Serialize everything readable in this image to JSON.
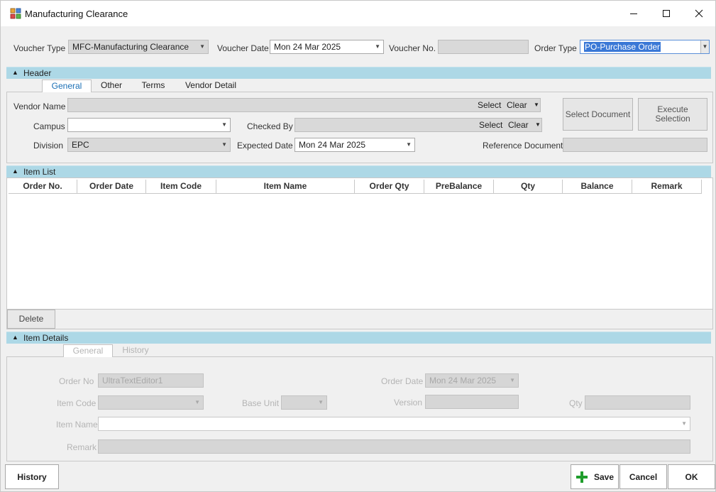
{
  "window": {
    "title": "Manufacturing Clearance"
  },
  "top": {
    "voucher_type_label": "Voucher Type",
    "voucher_type_value": "MFC-Manufacturing Clearance",
    "voucher_date_label": "Voucher Date",
    "voucher_date_value": "Mon 24 Mar 2025",
    "voucher_no_label": "Voucher No.",
    "voucher_no_value": "",
    "order_type_label": "Order Type",
    "order_type_value": "PO-Purchase Order"
  },
  "header": {
    "title": "Header",
    "tabs": [
      "General",
      "Other",
      "Terms",
      "Vendor Detail"
    ],
    "vendor_name_label": "Vendor Name",
    "vendor_name_value": "",
    "select_label": "Select",
    "clear_label": "Clear",
    "campus_label": "Campus",
    "campus_value": "",
    "checked_by_label": "Checked By",
    "checked_by_value": "",
    "division_label": "Division",
    "division_value": "EPC",
    "expected_date_label": "Expected Date",
    "expected_date_value": "Mon 24 Mar 2025",
    "reference_document_label": "Reference Document",
    "reference_document_value": "",
    "select_document_label": "Select Document",
    "execute_selection_line1": "Execute",
    "execute_selection_line2": "Selection"
  },
  "item_list": {
    "title": "Item List",
    "columns": [
      "Order No.",
      "Order Date",
      "Item Code",
      "Item Name",
      "Order Qty",
      "PreBalance",
      "Qty",
      "Balance",
      "Remark"
    ],
    "rows": [],
    "delete_label": "Delete"
  },
  "item_details": {
    "title": "Item Details",
    "tabs": [
      "General",
      "History"
    ],
    "order_no_label": "Order No",
    "order_no_value": "UltraTextEditor1",
    "order_date_label": "Order Date",
    "order_date_value": "Mon 24 Mar 2025",
    "item_code_label": "Item Code",
    "item_code_value": "",
    "base_unit_label": "Base Unit",
    "base_unit_value": "",
    "version_label": "Version",
    "version_value": "",
    "qty_label": "Qty",
    "qty_value": "",
    "item_name_label": "Item Name",
    "item_name_value": "",
    "remark_label": "Remark",
    "remark_value": ""
  },
  "footer": {
    "history_label": "History",
    "save_label": "Save",
    "cancel_label": "Cancel",
    "ok_label": "OK"
  },
  "colors": {
    "section_header": "#add8e6",
    "active_tab_text": "#1a6fb5",
    "selection_highlight": "#3a78d6",
    "save_icon": "#1f9d2c"
  }
}
